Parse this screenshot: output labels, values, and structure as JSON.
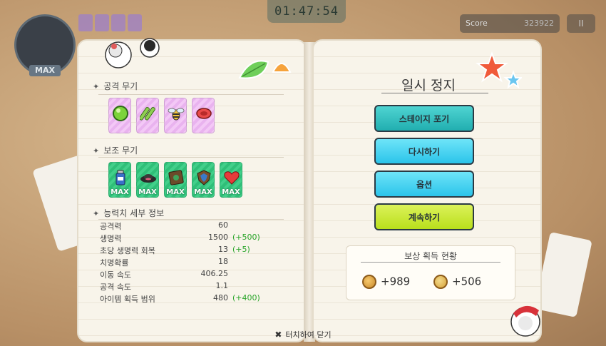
{
  "hud": {
    "timer": "01:47:54",
    "score_label": "Score",
    "score_value": "323922",
    "pause_icon": "II",
    "level_badge": "MAX"
  },
  "left_page": {
    "attack_title": "공격 무기",
    "attack_weapons": [
      {
        "icon": "green-orb-icon"
      },
      {
        "icon": "bamboo-icon"
      },
      {
        "icon": "bee-icon"
      },
      {
        "icon": "red-ring-icon"
      }
    ],
    "support_title": "보조 무기",
    "support_items": [
      {
        "icon": "potion-bottle-icon",
        "badge": "MAX"
      },
      {
        "icon": "hat-icon",
        "badge": "MAX"
      },
      {
        "icon": "book-icon",
        "badge": "MAX"
      },
      {
        "icon": "shield-icon",
        "badge": "MAX"
      },
      {
        "icon": "heart-icon",
        "badge": "MAX"
      }
    ],
    "stats_title": "능력치 세부 정보",
    "stats": [
      {
        "label": "공격력",
        "value": "60",
        "bonus": ""
      },
      {
        "label": "생명력",
        "value": "1500",
        "bonus": "(+500)"
      },
      {
        "label": "초당 생명력 회복",
        "value": "13",
        "bonus": "(+5)"
      },
      {
        "label": "치명확률",
        "value": "18",
        "bonus": ""
      },
      {
        "label": "이동 속도",
        "value": "406.25",
        "bonus": ""
      },
      {
        "label": "공격 속도",
        "value": "1.1",
        "bonus": ""
      },
      {
        "label": "아이템 획득 범위",
        "value": "480",
        "bonus": "(+400)"
      }
    ]
  },
  "right_page": {
    "title": "일시 정지",
    "buttons": {
      "give_up": "스테이지 포기",
      "retry": "다시하기",
      "options": "옵션",
      "continue": "계속하기"
    },
    "reward_title": "보상 획득 현황",
    "reward_coin_1": "+989",
    "reward_coin_2": "+506"
  },
  "footer": {
    "close_icon": "✖",
    "close_hint": "터치하여 닫기"
  },
  "colors": {
    "teal_button": "#21aeb0",
    "cyan_button": "#2bc4ea",
    "lime_button": "#b9df1c",
    "bonus_green": "#2aa52a",
    "purple_card": "#e9b3ef",
    "green_card": "#2fbf78"
  }
}
